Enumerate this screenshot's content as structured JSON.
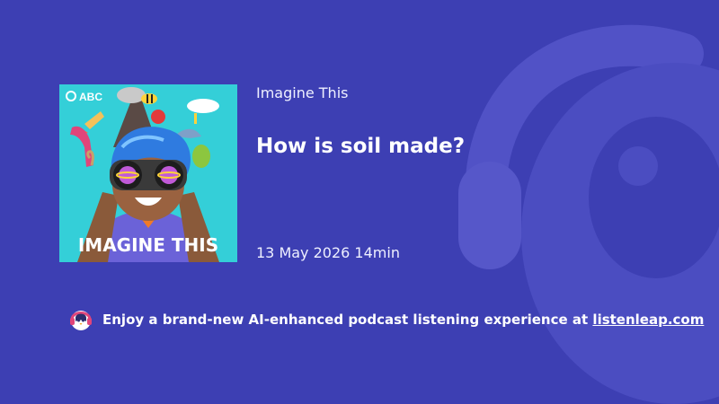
{
  "cover": {
    "brand": "ABC",
    "art_title": "IMAGINE THIS",
    "background": "#34cfd8"
  },
  "podcast": {
    "name": "Imagine This"
  },
  "episode": {
    "title": "How is soil made?",
    "date": "13 May 2026",
    "duration": "14min"
  },
  "promo": {
    "text": "Enjoy a brand-new AI-enhanced podcast listening experience at",
    "link_text": "listenleap.com",
    "icon": "penguin-headphones-icon"
  },
  "colors": {
    "background": "#3d3fb3",
    "text": "#ffffff"
  }
}
